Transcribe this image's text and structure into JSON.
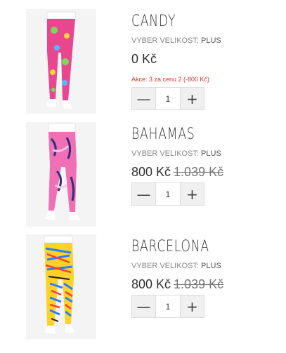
{
  "cart": {
    "items": [
      {
        "name": "CANDY",
        "size_label": "VYBER VELIKOST:",
        "size_value": "PLUS",
        "price": "0 Kč",
        "old_price": "",
        "promo": "Akce: 3 za cenu 2 (-800 Kč)",
        "quantity": "1",
        "minus": "—",
        "plus": "+",
        "pattern_colors": [
          "#e8478f",
          "#7ed957",
          "#f7d23c",
          "#55b8ff"
        ]
      },
      {
        "name": "BAHAMAS",
        "size_label": "VYBER VELIKOST:",
        "size_value": "PLUS",
        "price": "800 Kč",
        "old_price": "1.039 Kč",
        "promo": "",
        "quantity": "1",
        "minus": "—",
        "plus": "+",
        "pattern_colors": [
          "#f06fb5",
          "#2f2f7a",
          "#ffc6e4",
          "#ffffff"
        ]
      },
      {
        "name": "BARCELONA",
        "size_label": "VYBER VELIKOST:",
        "size_value": "PLUS",
        "price": "800 Kč",
        "old_price": "1.039 Kč",
        "promo": "",
        "quantity": "1",
        "minus": "—",
        "plus": "+",
        "pattern_colors": [
          "#ff3b3b",
          "#2a7fff",
          "#ffd22a",
          "#1f1f1f"
        ]
      }
    ]
  }
}
